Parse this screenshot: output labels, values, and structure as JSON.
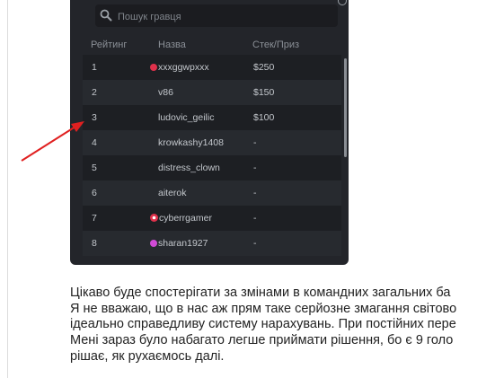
{
  "leaderboard": {
    "search_placeholder": "Пошук гравця",
    "columns": {
      "rank": "Рейтинг",
      "name": "Назва",
      "stack": "Стек/Приз"
    },
    "rows": [
      {
        "rank": "1",
        "name": "xxxggwpxxx",
        "prize": "$250",
        "icon": "red-dot",
        "icon_color": "#e0314b"
      },
      {
        "rank": "2",
        "name": "v86",
        "prize": "$150"
      },
      {
        "rank": "3",
        "name": "ludovic_geilic",
        "prize": "$100"
      },
      {
        "rank": "4",
        "name": "krowkashy1408",
        "prize": "-"
      },
      {
        "rank": "5",
        "name": "distress_clown",
        "prize": "-"
      },
      {
        "rank": "6",
        "name": "aiterok",
        "prize": "-"
      },
      {
        "rank": "7",
        "name": "cyberrgamer",
        "prize": "-",
        "icon": "red-ring-icon",
        "icon_color": "#e0314b"
      },
      {
        "rank": "8",
        "name": "sharan1927",
        "prize": "-",
        "icon": "magenta-dot",
        "icon_color": "#d14bd6"
      }
    ]
  },
  "annotation": {
    "arrow_color": "#e02020"
  },
  "article": {
    "lines": [
      "Цікаво буде спостерігати за змінами в командних загальних ба",
      "Я не вважаю, що в нас аж прям таке серйозне змагання світово",
      "ідеально справедливу систему нарахувань. При постійних пере",
      "Мені зараз було набагато легше приймати рішення, бо є 9 голо",
      "рішає, як рухаємось далі."
    ]
  }
}
